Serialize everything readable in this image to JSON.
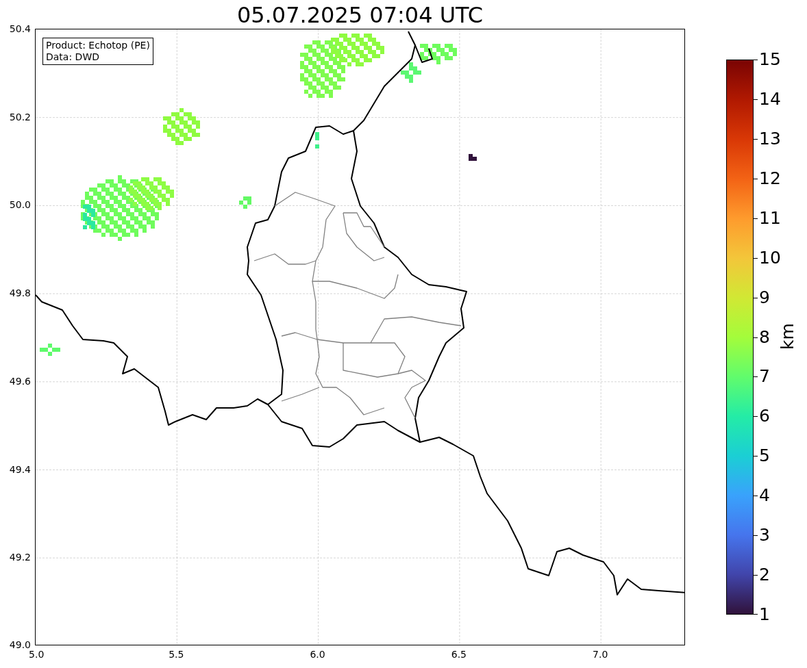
{
  "title": "05.07.2025 07:04 UTC",
  "info_box": [
    "Product: Echotop (PE)",
    "Data: DWD"
  ],
  "x_ticks": [
    "5.0",
    "5.5",
    "6.0",
    "6.5",
    "7.0"
  ],
  "y_ticks": [
    "50.4",
    "50.2",
    "50.0",
    "49.8",
    "49.6",
    "49.4",
    "49.2",
    "49.0"
  ],
  "colorbar": {
    "label": "km",
    "ticks": [
      "15",
      "14",
      "13",
      "12",
      "11",
      "10",
      "9",
      "8",
      "7",
      "6",
      "5",
      "4",
      "3",
      "2",
      "1"
    ]
  }
}
